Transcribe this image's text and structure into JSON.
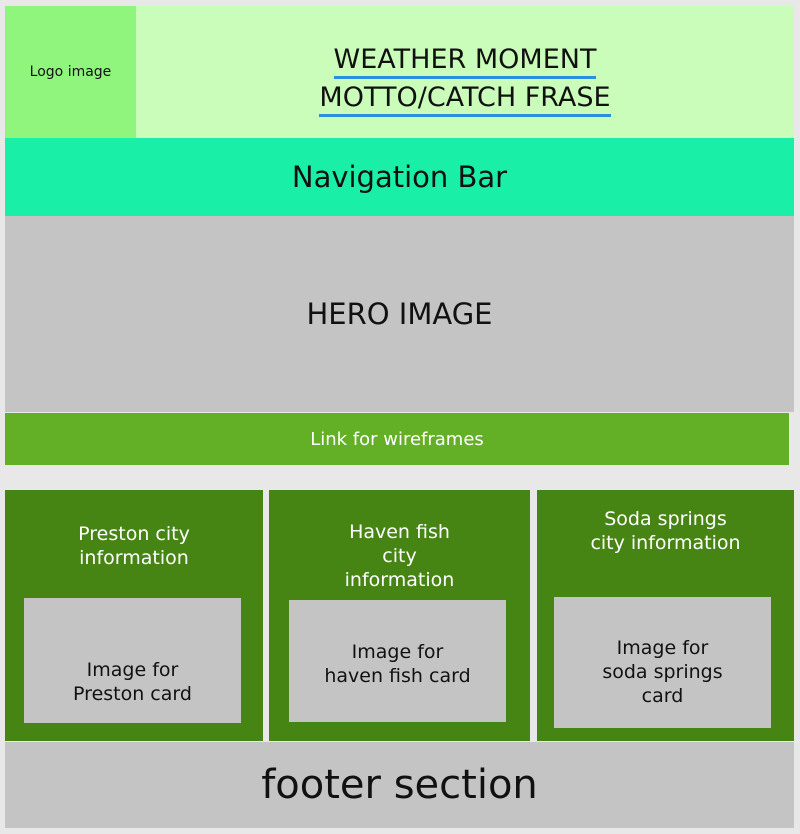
{
  "logo": {
    "label": "Logo image"
  },
  "header": {
    "title": "WEATHER MOMENT",
    "motto": "MOTTO/CATCH FRASE"
  },
  "nav": {
    "label": "Navigation Bar"
  },
  "hero": {
    "label": "HERO IMAGE"
  },
  "wireframes_link": {
    "label": "Link for wireframes"
  },
  "cards": [
    {
      "title_lines": [
        "Preston city",
        "information"
      ],
      "image_lines": [
        "Image for",
        "Preston card"
      ]
    },
    {
      "title_lines": [
        "Haven fish",
        "city",
        "information"
      ],
      "image_lines": [
        "Image for",
        "haven fish card"
      ]
    },
    {
      "title_lines": [
        "Soda springs",
        "city information"
      ],
      "image_lines": [
        "Image for",
        "soda springs",
        "card"
      ]
    }
  ],
  "footer": {
    "label": "footer section"
  },
  "colors": {
    "logo_bg": "#8ff57d",
    "header_bg": "#cbfdba",
    "nav_bg": "#19efa6",
    "placeholder_gray": "#c4c4c4",
    "link_bar": "#63af26",
    "card_bg": "#468414",
    "spellcheck_underline": "#2a8fe0"
  }
}
